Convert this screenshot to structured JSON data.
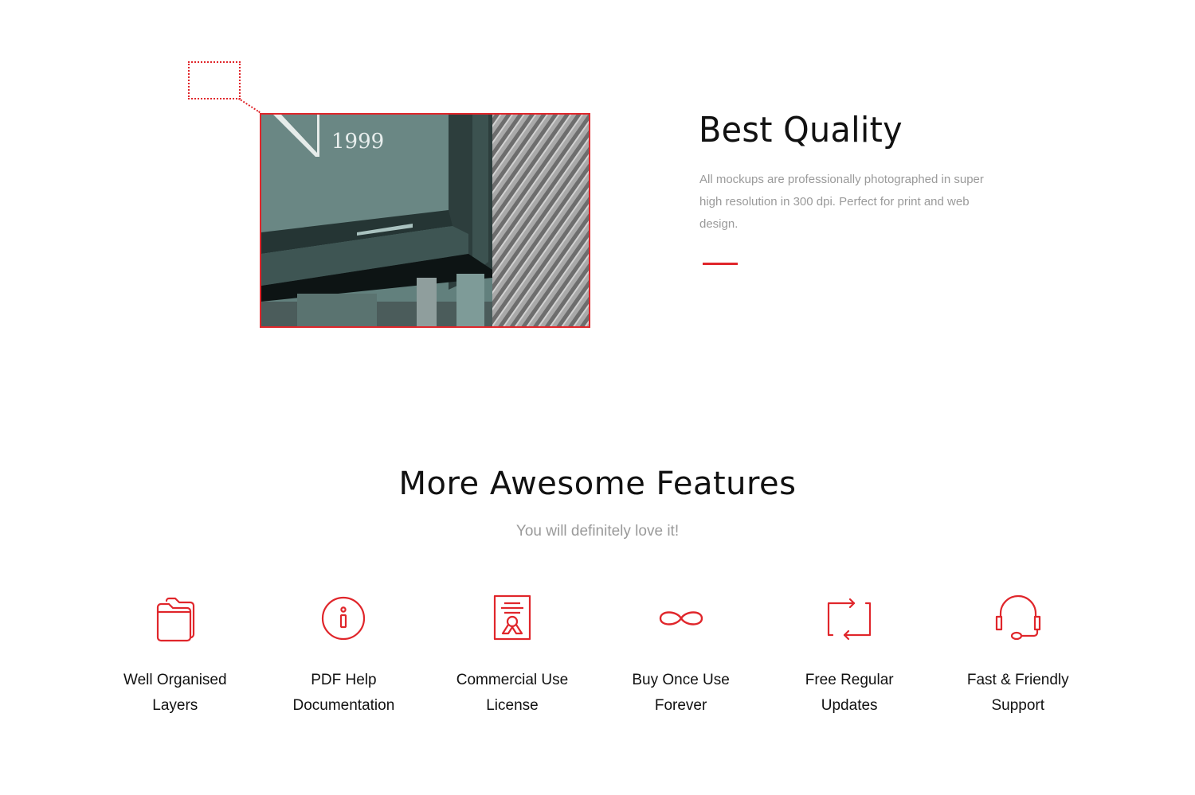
{
  "preview": {
    "image_text": "1999"
  },
  "best_quality": {
    "title": "Best Quality",
    "description": "All mockups are professionally photographed in super high resolution in 300 dpi. Perfect for print and web design."
  },
  "features": {
    "title": "More Awesome Features",
    "subtitle": "You will definitely love it!",
    "items": [
      {
        "icon": "folder-icon",
        "line1": "Well Organised",
        "line2": "Layers"
      },
      {
        "icon": "info-icon",
        "line1": "PDF Help",
        "line2": "Documentation"
      },
      {
        "icon": "certificate-icon",
        "line1": "Commercial Use",
        "line2": "License"
      },
      {
        "icon": "infinity-icon",
        "line1": "Buy Once Use",
        "line2": "Forever"
      },
      {
        "icon": "refresh-icon",
        "line1": "Free Regular",
        "line2": "Updates"
      },
      {
        "icon": "headset-icon",
        "line1": "Fast & Friendly",
        "line2": "Support"
      }
    ]
  },
  "colors": {
    "accent": "#e0262b",
    "text": "#111111",
    "muted": "#9a9a9a"
  }
}
